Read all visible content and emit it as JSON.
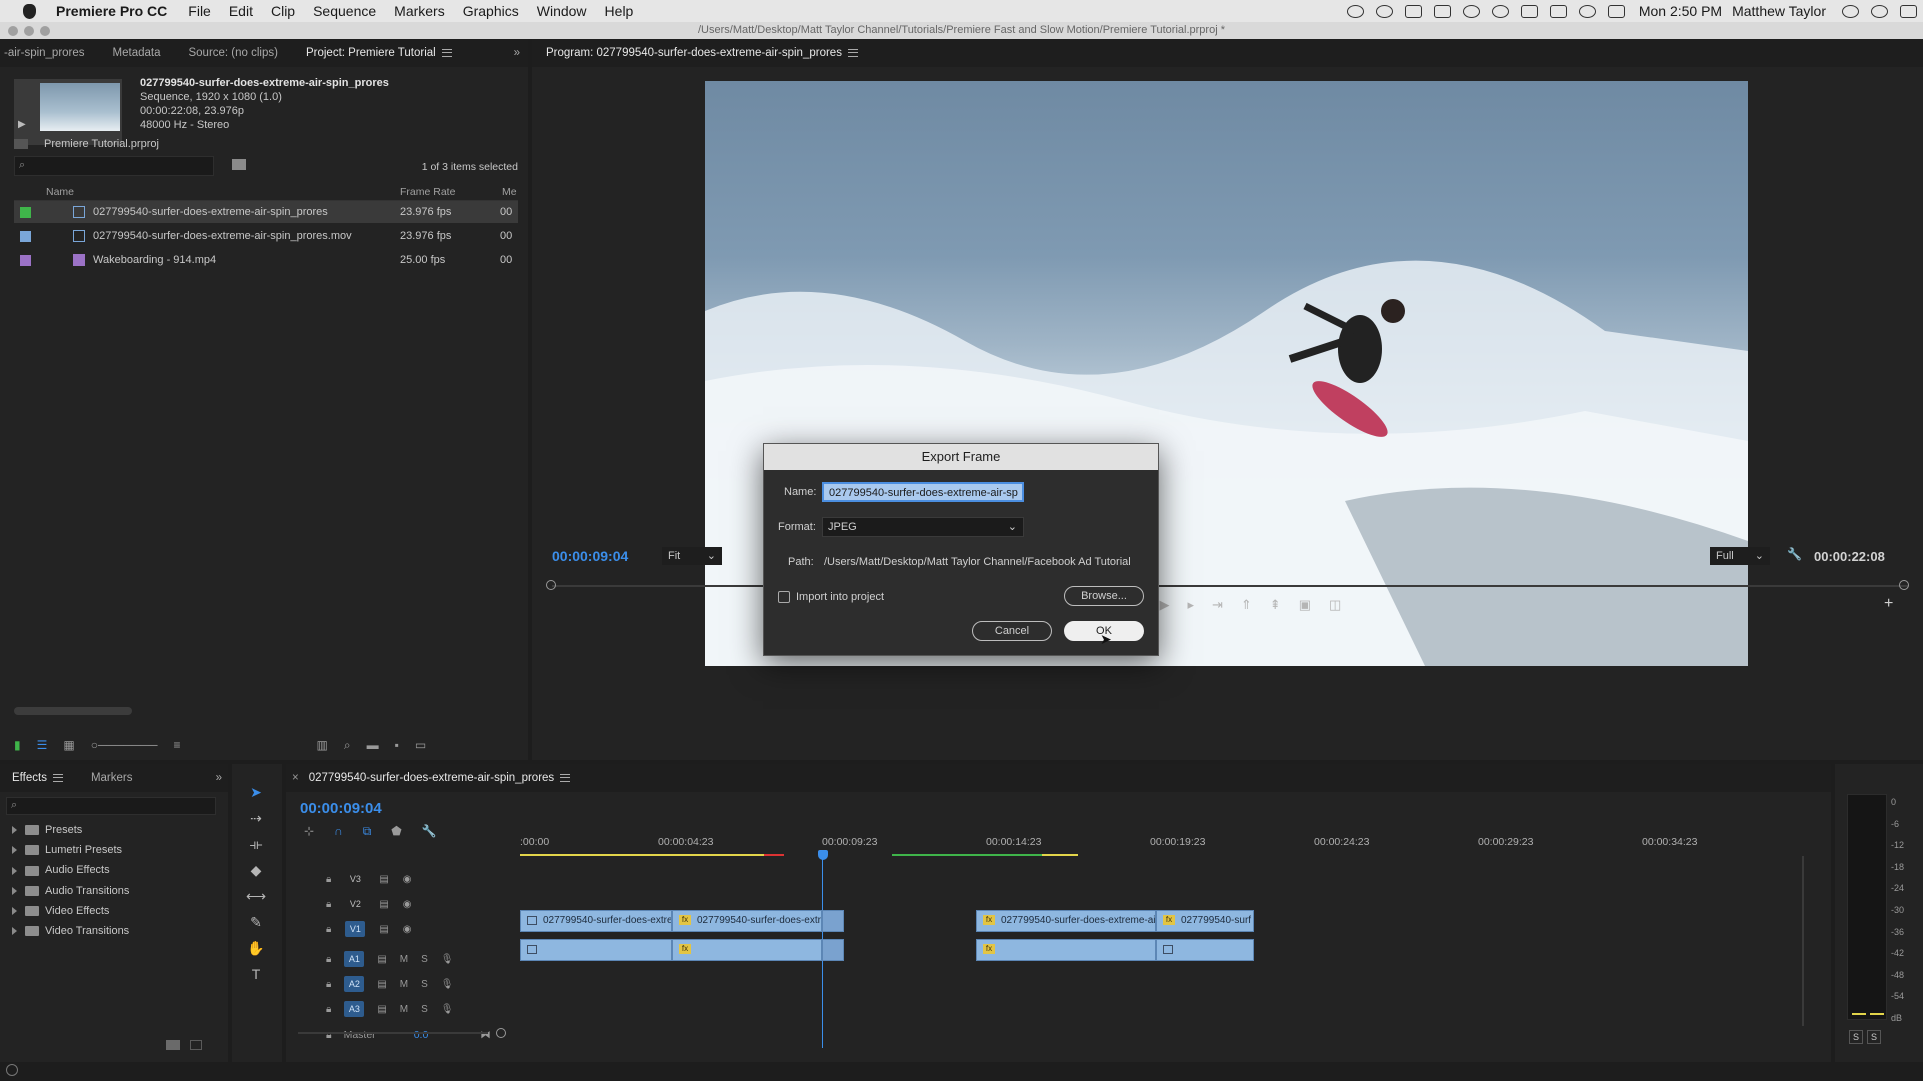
{
  "menubar": {
    "app_name": "Premiere Pro CC",
    "items": [
      "File",
      "Edit",
      "Clip",
      "Sequence",
      "Markers",
      "Graphics",
      "Window",
      "Help"
    ],
    "clock": "Mon 2:50 PM",
    "user": "Matthew Taylor"
  },
  "titlebar": {
    "title": "/Users/Matt/Desktop/Matt Taylor Channel/Tutorials/Premiere Fast and Slow Motion/Premiere Tutorial.prproj *"
  },
  "project_panel": {
    "tabs": [
      "-air-spin_prores",
      "Metadata",
      "Source: (no clips)",
      "Project: Premiere Tutorial"
    ],
    "preview": {
      "name": "027799540-surfer-does-extreme-air-spin_prores",
      "line1": "Sequence, 1920 x 1080 (1.0)",
      "line2": "00:00:22:08, 23.976p",
      "line3": "48000 Hz - Stereo"
    },
    "project_file": "Premiere Tutorial.prproj",
    "selection_status": "1 of 3 items selected",
    "columns": {
      "name": "Name",
      "frame_rate": "Frame Rate",
      "media": "Me"
    },
    "items": [
      {
        "name": "027799540-surfer-does-extreme-air-spin_prores",
        "fps": "23.976 fps",
        "extra": "00",
        "color": "#3fb54a"
      },
      {
        "name": "027799540-surfer-does-extreme-air-spin_prores.mov",
        "fps": "23.976 fps",
        "extra": "00",
        "color": "#7aa6d8"
      },
      {
        "name": "Wakeboarding - 914.mp4",
        "fps": "25.00 fps",
        "extra": "00",
        "color": "#9b72c6"
      }
    ]
  },
  "program_monitor": {
    "title": "Program: 027799540-surfer-does-extreme-air-spin_prores",
    "current_time": "00:00:09:04",
    "fit": "Fit",
    "quality": "Full",
    "duration": "00:00:22:08"
  },
  "export_dialog": {
    "title": "Export Frame",
    "name_label": "Name:",
    "name_value": "027799540-surfer-does-extreme-air-sp",
    "format_label": "Format:",
    "format_value": "JPEG",
    "path_label": "Path:",
    "path_value": "/Users/Matt/Desktop/Matt Taylor Channel/Facebook Ad Tutorial",
    "import_label": "Import into project",
    "browse_label": "Browse...",
    "cancel_label": "Cancel",
    "ok_label": "OK"
  },
  "effects_panel": {
    "tabs": [
      "Effects",
      "Markers"
    ],
    "items": [
      "Presets",
      "Lumetri Presets",
      "Audio Effects",
      "Audio Transitions",
      "Video Effects",
      "Video Transitions"
    ]
  },
  "timeline": {
    "sequence_name": "027799540-surfer-does-extreme-air-spin_prores",
    "timecode": "00:00:09:04",
    "ruler": [
      ":00:00",
      "00:00:04:23",
      "00:00:09:23",
      "00:00:14:23",
      "00:00:19:23",
      "00:00:24:23",
      "00:00:29:23",
      "00:00:34:23"
    ],
    "video_tracks": [
      "V3",
      "V2",
      "V1"
    ],
    "audio_tracks": [
      "A1",
      "A2",
      "A3"
    ],
    "master_label": "Master",
    "master_value": "0.0",
    "clips": [
      "027799540-surfer-does-extre",
      "027799540-surfer-does-extr",
      "027799540-surfer-does-extreme-air-",
      "027799540-surf"
    ]
  },
  "audio_meter": {
    "labels": [
      "0",
      "-6",
      "-12",
      "-18",
      "-24",
      "-30",
      "-36",
      "-42",
      "-48",
      "-54",
      "dB"
    ],
    "solo": [
      "S",
      "S"
    ]
  },
  "colors": {
    "accent": "#3b8eea",
    "clip": "#8eb7e0",
    "panel": "#232323"
  }
}
